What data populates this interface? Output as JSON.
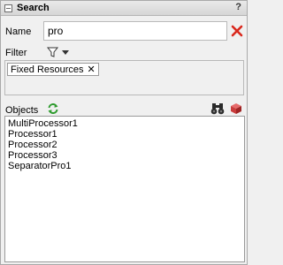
{
  "window": {
    "title": "Search",
    "help_label": "?"
  },
  "name_field": {
    "label": "Name",
    "value": "pro"
  },
  "filter": {
    "label": "Filter",
    "chips": [
      {
        "label": "Fixed Resources",
        "remove_label": "✕"
      }
    ]
  },
  "objects": {
    "label": "Objects",
    "items": [
      {
        "label": "MultiProcessor1"
      },
      {
        "label": "Processor1"
      },
      {
        "label": "Processor2"
      },
      {
        "label": "Processor3"
      },
      {
        "label": "SeparatorPro1"
      }
    ]
  },
  "icons": {
    "clear": "close-icon",
    "filter": "funnel-icon",
    "refresh": "refresh-icon",
    "find": "binoculars-icon",
    "select": "cube-icon"
  },
  "colors": {
    "clear_red": "#d9281d",
    "refresh_green": "#2e9b2e",
    "cube_red": "#c93c3c"
  }
}
